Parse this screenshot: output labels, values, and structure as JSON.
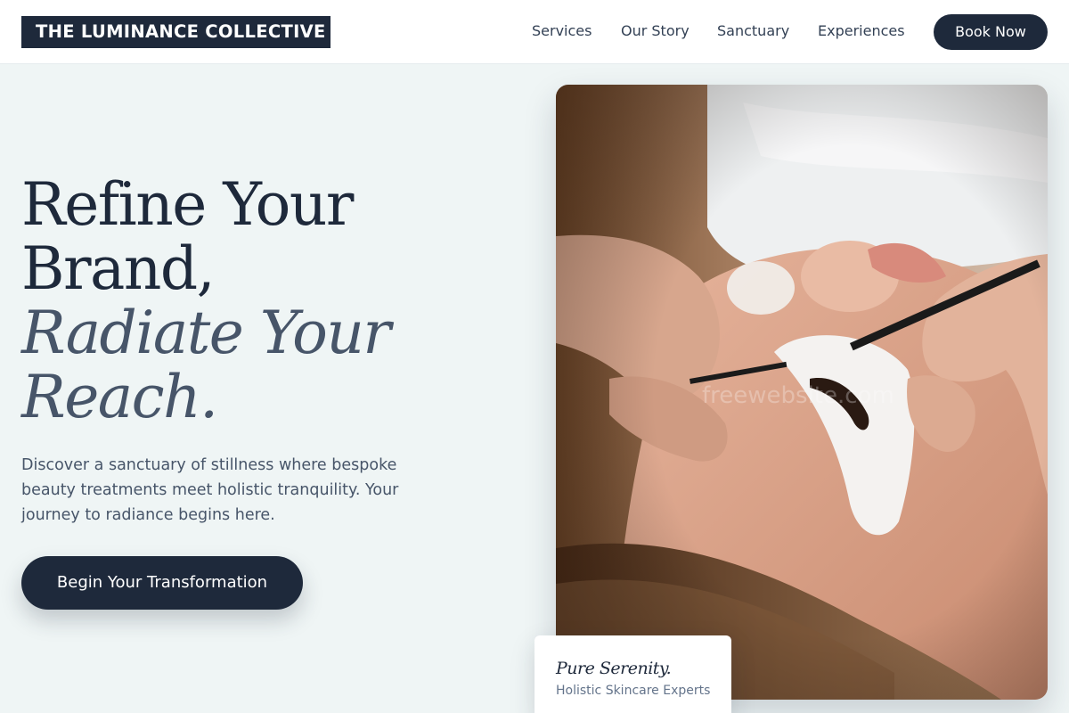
{
  "brand": {
    "logo_text": "THE LUMINANCE COLLECTIVE"
  },
  "nav": {
    "items": [
      {
        "label": "Services"
      },
      {
        "label": "Our Story"
      },
      {
        "label": "Sanctuary"
      },
      {
        "label": "Experiences"
      }
    ],
    "cta_label": "Book Now"
  },
  "hero": {
    "headline_line1": "Refine Your",
    "headline_line2": "Brand,",
    "headline_line3": "Radiate Your",
    "headline_line4": "Reach.",
    "lead": "Discover a sanctuary of stillness where bespoke beauty treatments meet holistic tranquility. Your journey to radiance begins here.",
    "cta_label": "Begin Your Transformation"
  },
  "image": {
    "watermark": "freewebsite.com"
  },
  "card": {
    "title": "Pure Serenity.",
    "subtitle": "Holistic Skincare Experts"
  },
  "colors": {
    "primary": "#1e293b",
    "background": "#eff5f5",
    "muted": "#475569"
  }
}
